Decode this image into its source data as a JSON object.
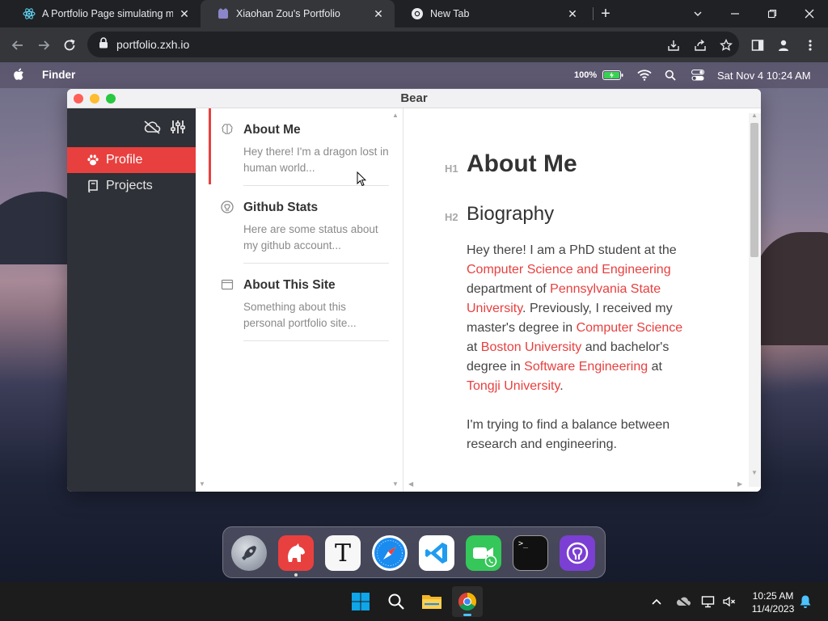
{
  "browser": {
    "tabs": [
      {
        "title": "A Portfolio Page simulating macOS",
        "icon": "react-icon",
        "active": false
      },
      {
        "title": "Xiaohan Zou's Portfolio",
        "icon": "bear-favicon",
        "active": true
      },
      {
        "title": "New Tab",
        "icon": "chrome-icon",
        "active": false
      }
    ],
    "new_tab_label": "+",
    "url": "portfolio.zxh.io"
  },
  "menubar": {
    "app_name": "Finder",
    "battery_percent": "100%",
    "datetime": "Sat Nov 4 10:24 AM"
  },
  "bear": {
    "window_title": "Bear",
    "sidebar": {
      "items": [
        {
          "label": "Profile",
          "icon": "paw-icon",
          "active": true
        },
        {
          "label": "Projects",
          "icon": "book-icon",
          "active": false
        }
      ]
    },
    "notes": [
      {
        "title": "About Me",
        "excerpt": "Hey there! I'm a dragon lost in human world...",
        "icon": "brain-icon",
        "active": true
      },
      {
        "title": "Github Stats",
        "excerpt": "Here are some status about my github account...",
        "icon": "github-icon",
        "active": false
      },
      {
        "title": "About This Site",
        "excerpt": "Something about this personal portfolio site...",
        "icon": "browser-window-icon",
        "active": false
      }
    ],
    "editor": {
      "h1_marker": "H1",
      "h1": "About Me",
      "h2_marker": "H2",
      "h2": "Biography",
      "bio": {
        "t1": "Hey there! I am a PhD student at the ",
        "l1": "Computer Science and Engineering",
        "t2": " department of ",
        "l2": "Pennsylvania State University",
        "t3": ". Previously, I received my master's degree in ",
        "l3": "Computer Science",
        "t4": " at ",
        "l4": "Boston University",
        "t5": " and bachelor's degree in ",
        "l5": "Software Engineering",
        "t6": " at ",
        "l6": "Tongji University",
        "t7": "."
      },
      "para2": "I'm trying to find a balance between research and engineering."
    }
  },
  "dock": {
    "apps": [
      "launchpad-icon",
      "bear-app-icon",
      "typora-icon",
      "safari-icon",
      "vscode-icon",
      "facetime-icon",
      "terminal-icon",
      "github-icon"
    ],
    "terminal_glyph": ">_",
    "typora_glyph": "T"
  },
  "taskbar": {
    "time": "10:25 AM",
    "date": "11/4/2023"
  },
  "colors": {
    "accent": "#e8403f",
    "sidebar_bg": "#2e3137",
    "chrome_dark": "#202124",
    "chrome_toolbar": "#35363a"
  }
}
